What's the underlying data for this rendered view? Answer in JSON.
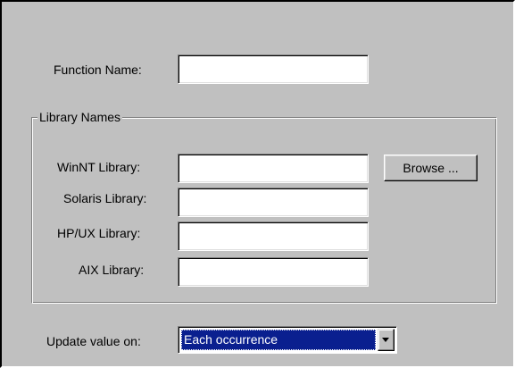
{
  "form": {
    "function_name_label": "Function Name:",
    "function_name_value": ""
  },
  "library_group": {
    "title": "Library Names",
    "winnt_label": "WinNT Library:",
    "winnt_value": "",
    "solaris_label": "Solaris Library:",
    "solaris_value": "",
    "hpux_label": "HP/UX Library:",
    "hpux_value": "",
    "aix_label": "AIX Library:",
    "aix_value": "",
    "browse_label": "Browse ..."
  },
  "update": {
    "label": "Update value on:",
    "selected": "Each occurrence",
    "arrow_icon": "chevron-down-icon"
  },
  "colors": {
    "dialog_background": "#c0c0c0",
    "selection_background": "#0a1f8f",
    "selection_text": "#ffffff"
  }
}
